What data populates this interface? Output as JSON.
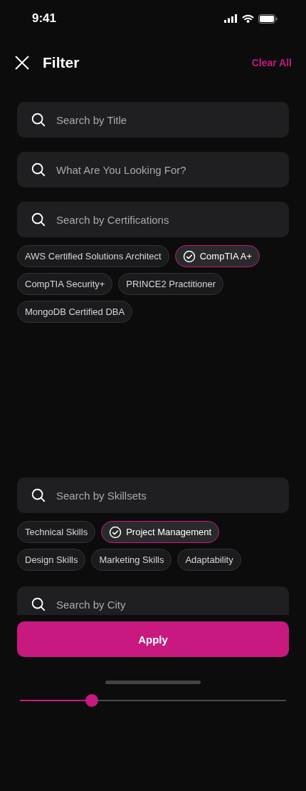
{
  "status_bar": {
    "time": "9:41"
  },
  "header": {
    "title": "Filter",
    "action": "Clear All"
  },
  "search_fields": [
    {
      "placeholder": "Search by Title"
    },
    {
      "placeholder": "What Are You Looking For?"
    }
  ],
  "certifications": {
    "placeholder": "Search by Certifications",
    "chips": [
      {
        "label": "AWS Certified Solutions Architect",
        "selected": false
      },
      {
        "label": "CompTIA A+",
        "selected": true
      },
      {
        "label": "CompTIA Security+",
        "selected": false
      },
      {
        "label": "PRINCE2 Practitioner",
        "selected": false
      },
      {
        "label": "MongoDB Certified DBA",
        "selected": false
      }
    ]
  },
  "skillsets": {
    "placeholder": "Search by Skillsets",
    "chips": [
      {
        "label": "Technical Skills",
        "selected": false
      },
      {
        "label": "Project Management",
        "selected": true
      },
      {
        "label": "Design Skills",
        "selected": false
      },
      {
        "label": "Marketing Skills",
        "selected": false
      },
      {
        "label": "Adaptability",
        "selected": false
      }
    ]
  },
  "city_field": {
    "placeholder": "Search by City"
  },
  "apply_button": "Apply",
  "slider": {
    "level": 0.27
  }
}
